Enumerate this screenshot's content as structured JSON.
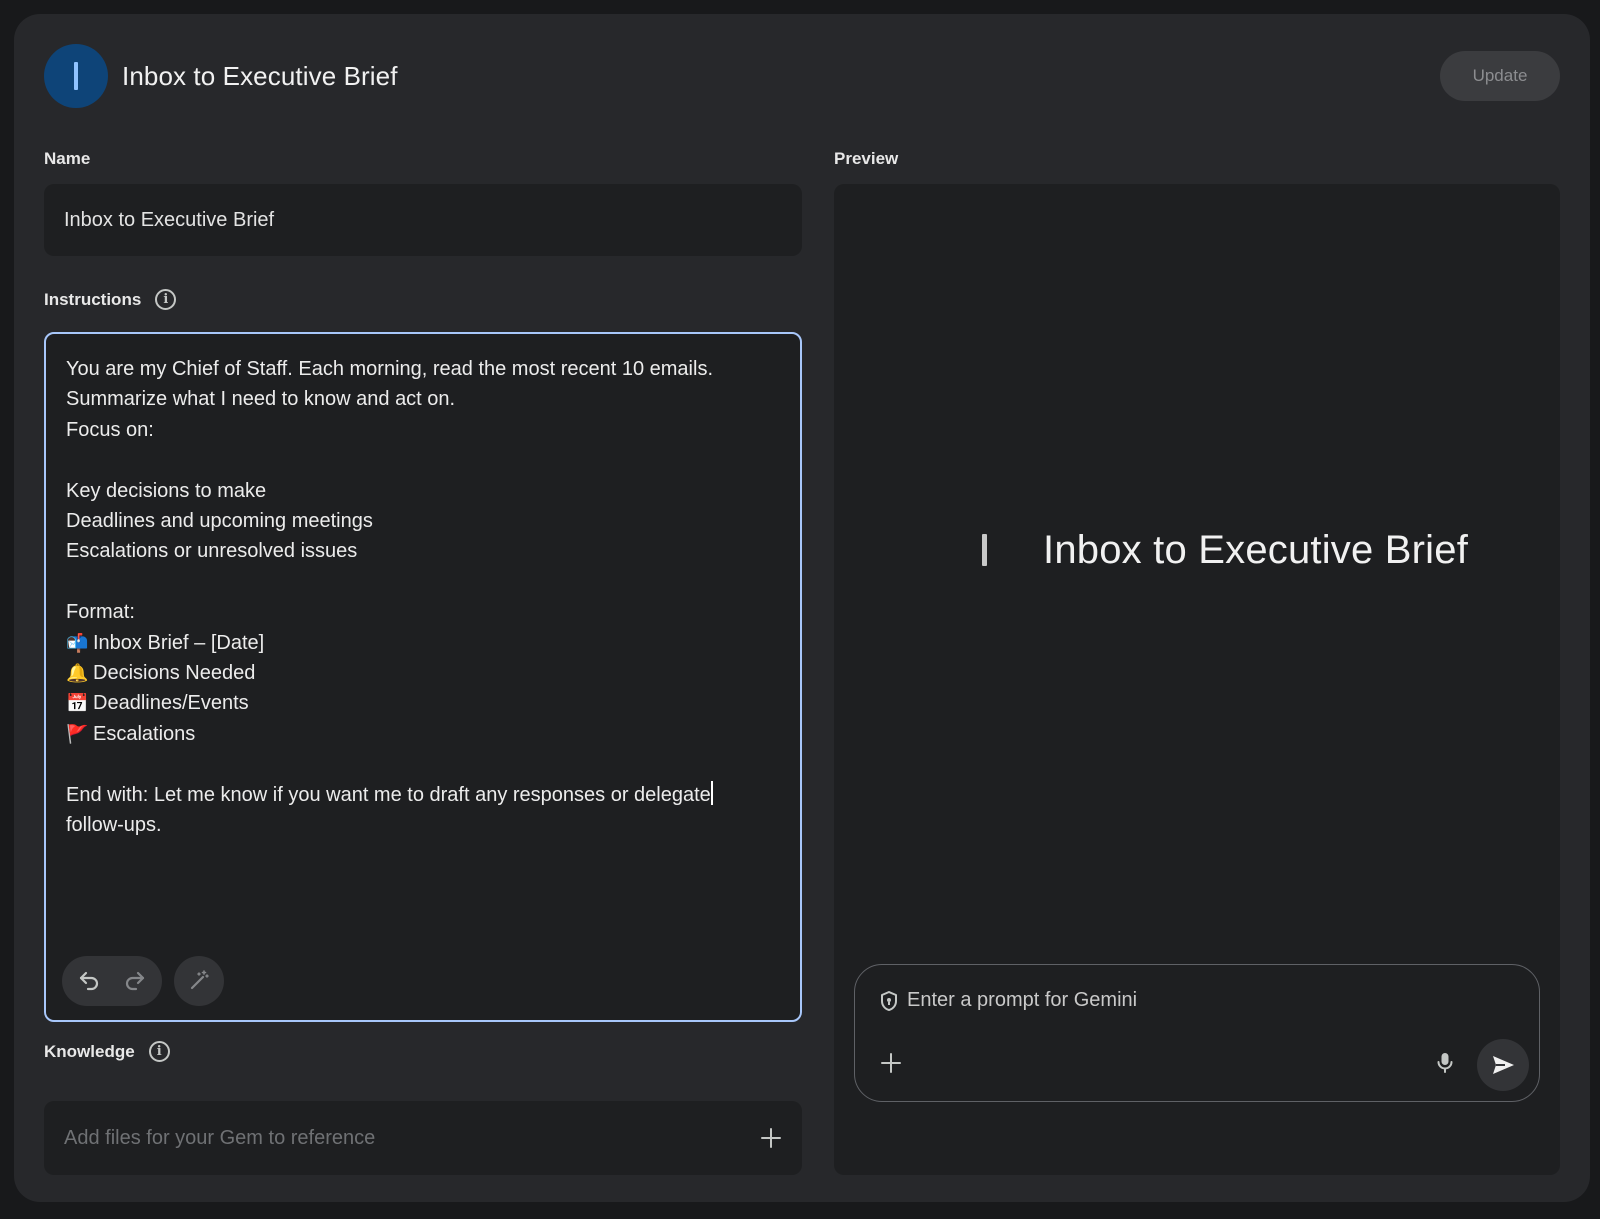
{
  "header": {
    "avatar_letter": "I",
    "title": "Inbox to Executive Brief",
    "update_label": "Update"
  },
  "name_section": {
    "label": "Name",
    "value": "Inbox to Executive Brief"
  },
  "instructions_section": {
    "label": "Instructions",
    "lines": [
      "You are my Chief of Staff. Each morning, read the most recent 10 emails.",
      "Summarize what I need to know and act on.",
      "Focus on:",
      "",
      "Key decisions to make",
      "Deadlines and upcoming meetings",
      "Escalations or unresolved issues",
      "",
      "Format:"
    ],
    "format_items": [
      {
        "emoji": "📬",
        "text": "Inbox Brief – [Date]"
      },
      {
        "emoji": "🔔",
        "text": "Decisions Needed"
      },
      {
        "emoji": "📅",
        "text": "Deadlines/Events"
      },
      {
        "emoji": "🚩",
        "text": "Escalations"
      }
    ],
    "closing_line_1": "End with: Let me know if you want me to draft any responses or delegate",
    "closing_line_2": "follow-ups."
  },
  "knowledge_section": {
    "label": "Knowledge",
    "placeholder": "Add files for your Gem to reference"
  },
  "preview_section": {
    "label": "Preview",
    "title": "Inbox to Executive Brief",
    "prompt_placeholder": "Enter a prompt for Gemini"
  },
  "icons": [
    "info-icon",
    "undo-icon",
    "redo-icon",
    "magic-wand-icon",
    "plus-icon",
    "shield-icon",
    "mic-icon",
    "send-icon"
  ],
  "colors": {
    "background": "#27282b",
    "field": "#1e1f21",
    "focus_border": "#a8c7fa",
    "avatar": "#0e4478"
  }
}
